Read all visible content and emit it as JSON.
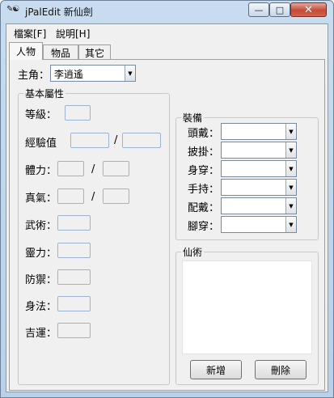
{
  "window": {
    "title": "jPalEdit 新仙劍",
    "icon_name": "jpaledit-app-icon",
    "minimize": "—",
    "maximize": "□",
    "close": "✕"
  },
  "menu": {
    "items": [
      {
        "label": "檔案[F]"
      },
      {
        "label": "說明[H]"
      }
    ]
  },
  "tabs": [
    {
      "label": "人物",
      "active": true
    },
    {
      "label": "物品",
      "active": false
    },
    {
      "label": "其它",
      "active": false
    }
  ],
  "character": {
    "label": "主角：",
    "selected": "李逍遙"
  },
  "attributes": {
    "group_title": "基本屬性",
    "level_label": "等級：",
    "exp_label": "經驗值",
    "slash": "/",
    "hp_label": "體力：",
    "mp_label": "真氣：",
    "attack_label": "武術：",
    "magic_label": "靈力：",
    "defense_label": "防禦：",
    "speed_label": "身法：",
    "luck_label": "吉運："
  },
  "equipment": {
    "group_title": "裝備",
    "slots": [
      {
        "label": "頭戴："
      },
      {
        "label": "披掛："
      },
      {
        "label": "身穿："
      },
      {
        "label": "手持："
      },
      {
        "label": "配戴："
      },
      {
        "label": "腳穿："
      }
    ]
  },
  "magic": {
    "group_title": "仙術",
    "add_label": "新增",
    "delete_label": "刪除"
  },
  "colors": {
    "title_gradient_top": "#c9dcef",
    "close_button": "#c44b36",
    "panel_bg": "#f0f0f0",
    "field_border": "#9db3cf"
  }
}
